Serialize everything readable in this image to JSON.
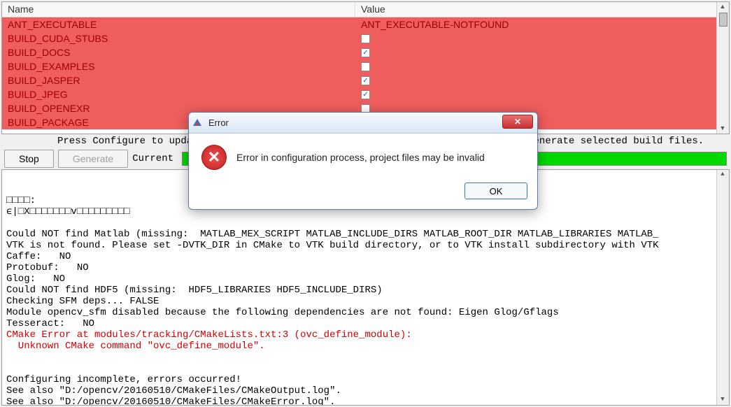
{
  "table": {
    "headers": {
      "name": "Name",
      "value": "Value"
    },
    "rows": [
      {
        "name": "ANT_EXECUTABLE",
        "type": "text",
        "value": "ANT_EXECUTABLE-NOTFOUND"
      },
      {
        "name": "BUILD_CUDA_STUBS",
        "type": "check",
        "checked": false
      },
      {
        "name": "BUILD_DOCS",
        "type": "check",
        "checked": true
      },
      {
        "name": "BUILD_EXAMPLES",
        "type": "check",
        "checked": false
      },
      {
        "name": "BUILD_JASPER",
        "type": "check",
        "checked": true
      },
      {
        "name": "BUILD_JPEG",
        "type": "check",
        "checked": true
      },
      {
        "name": "BUILD_OPENEXR",
        "type": "check",
        "checked": false
      },
      {
        "name": "BUILD_PACKAGE",
        "type": "check",
        "checked": false
      }
    ]
  },
  "hint": "Press Configure to update and display new values in red, then press Generate to generate selected build files.",
  "controls": {
    "stop": "Stop",
    "generate": "Generate",
    "current_label": "Current"
  },
  "log_lines": [
    {
      "text": "□□□□:",
      "cls": ""
    },
    {
      "text": "ϵ|□X□□□□□□□v□□□□□□□□□",
      "cls": ""
    },
    {
      "text": "",
      "cls": ""
    },
    {
      "text": "Could NOT find Matlab (missing:  MATLAB_MEX_SCRIPT MATLAB_INCLUDE_DIRS MATLAB_ROOT_DIR MATLAB_LIBRARIES MATLAB_",
      "cls": ""
    },
    {
      "text": "VTK is not found. Please set -DVTK_DIR in CMake to VTK build directory, or to VTK install subdirectory with VTK",
      "cls": ""
    },
    {
      "text": "Caffe:   NO",
      "cls": ""
    },
    {
      "text": "Protobuf:   NO",
      "cls": ""
    },
    {
      "text": "Glog:   NO",
      "cls": ""
    },
    {
      "text": "Could NOT find HDF5 (missing:  HDF5_LIBRARIES HDF5_INCLUDE_DIRS)",
      "cls": ""
    },
    {
      "text": "Checking SFM deps... FALSE",
      "cls": ""
    },
    {
      "text": "Module opencv_sfm disabled because the following dependencies are not found: Eigen Glog/Gflags",
      "cls": ""
    },
    {
      "text": "Tesseract:   NO",
      "cls": ""
    },
    {
      "text": "CMake Error at modules/tracking/CMakeLists.txt:3 (ovc_define_module):",
      "cls": "log-error"
    },
    {
      "text": "  Unknown CMake command \"ovc_define_module\".",
      "cls": "log-error"
    },
    {
      "text": "",
      "cls": ""
    },
    {
      "text": "",
      "cls": ""
    },
    {
      "text": "Configuring incomplete, errors occurred!",
      "cls": ""
    },
    {
      "text": "See also \"D:/opencv/20160510/CMakeFiles/CMakeOutput.log\".",
      "cls": ""
    },
    {
      "text": "See also \"D:/opencv/20160510/CMakeFiles/CMakeError.log\".",
      "cls": ""
    }
  ],
  "dialog": {
    "title": "Error",
    "message": "Error in configuration process, project files may be invalid",
    "ok": "OK",
    "close_glyph": "✕"
  }
}
